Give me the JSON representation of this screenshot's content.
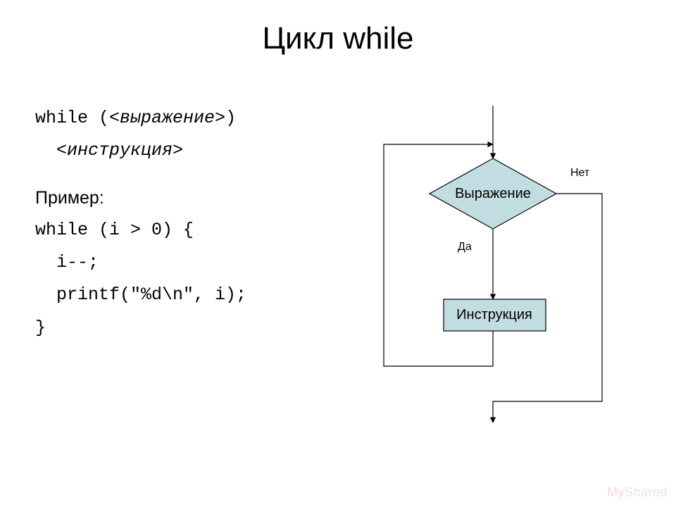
{
  "title": "Цикл while",
  "syntax": {
    "line1_prefix": "while (",
    "line1_expr": "<выражение>",
    "line1_suffix": ")",
    "line2": "<инструкция>"
  },
  "example": {
    "heading": "Пример:",
    "l1": "while (i > 0) {",
    "l2": "  i--;",
    "l3": "  printf(\"%d\\n\", i);",
    "l4": "}"
  },
  "flow": {
    "decision": "Выражение",
    "yes": "Да",
    "no": "Нет",
    "process": "Инструкция"
  },
  "watermark": {
    "my": "My",
    "shared": "Shared"
  },
  "colors": {
    "node_fill": "#c2dde2",
    "node_stroke": "#000000"
  }
}
